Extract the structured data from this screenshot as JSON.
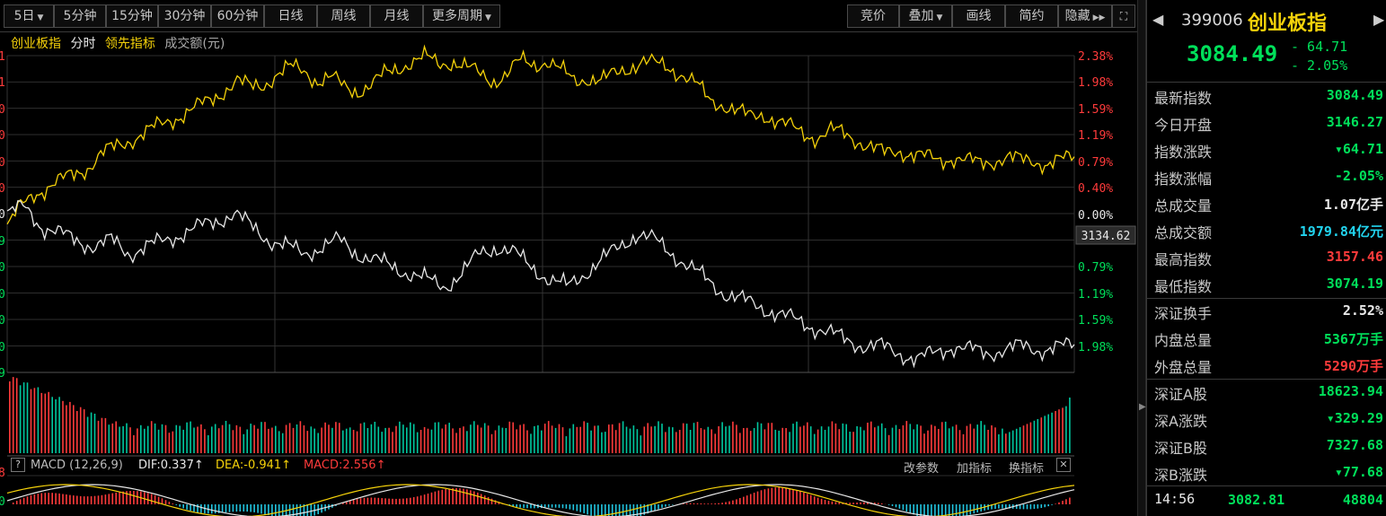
{
  "toolbar": {
    "period_items": [
      "5日",
      "5分钟",
      "15分钟",
      "30分钟",
      "60分钟",
      "日线",
      "周线",
      "月线",
      "更多周期"
    ],
    "right_items": [
      "竞价",
      "叠加",
      "画线",
      "简约",
      "隐藏"
    ]
  },
  "legend": {
    "items": [
      "创业板指",
      "分时",
      "领先指标",
      "成交额(元)"
    ]
  },
  "axis": {
    "right_labels_up": [
      "2.38%",
      "1.98%",
      "1.59%",
      "1.19%",
      "0.79%",
      "0.40%"
    ],
    "zero_label": "0.00%",
    "right_labels_down": [
      "0.79%",
      "1.19%",
      "1.59%",
      "1.98%"
    ],
    "prev_close": "3134.62",
    "left_labels": [
      "1",
      "1",
      "0",
      "0",
      "0",
      "0",
      "0",
      "9",
      "0",
      "0",
      "0",
      "0",
      "9"
    ]
  },
  "chart_data": {
    "type": "line",
    "series": [
      {
        "name": "领先指标",
        "color": "#f5d20a",
        "values": [
          -0.2,
          0.1,
          0.3,
          0.4,
          0.5,
          0.6,
          0.7,
          0.9,
          1.0,
          1.1,
          1.2,
          1.3,
          1.4,
          1.5,
          1.6,
          1.7,
          1.85,
          2.0,
          1.9,
          1.95,
          2.1,
          2.2,
          2.15,
          2.0,
          2.05,
          1.9,
          1.85,
          1.95,
          2.1,
          2.2,
          2.3,
          2.35,
          2.25,
          2.3,
          2.2,
          2.1,
          2.0,
          2.1,
          2.3,
          2.25,
          2.3,
          2.15,
          2.0,
          2.05,
          2.0,
          2.1,
          2.2,
          2.3,
          2.25,
          2.2,
          2.1,
          1.95,
          1.7,
          1.65,
          1.55,
          1.45,
          1.5,
          1.4,
          1.3,
          1.2,
          1.15,
          1.25,
          1.2,
          1.1,
          1.0,
          0.9,
          0.95,
          0.9,
          0.85,
          0.8,
          0.85,
          0.8,
          0.75,
          0.8,
          0.85,
          0.8,
          0.8,
          0.75,
          0.8,
          0.85
        ]
      },
      {
        "name": "创业板指",
        "color": "#e8e8e8",
        "values": [
          0.0,
          0.1,
          -0.2,
          -0.3,
          -0.4,
          -0.5,
          -0.4,
          -0.6,
          -0.5,
          -0.4,
          -0.3,
          -0.2,
          -0.1,
          0.0,
          -0.2,
          -0.4,
          -0.5,
          -0.6,
          -0.5,
          -0.4,
          -0.6,
          -0.7,
          -0.8,
          -0.9,
          -1.0,
          -1.1,
          -0.9,
          -0.6,
          -0.5,
          -0.6,
          -0.8,
          -1.0,
          -1.1,
          -0.9,
          -0.7,
          -0.5,
          -0.3,
          -0.4,
          -0.6,
          -0.8,
          -1.0,
          -1.2,
          -1.3,
          -1.4,
          -1.5,
          -1.6,
          -1.7,
          -1.8,
          -1.9,
          -2.0,
          -2.0,
          -2.1,
          -2.2,
          -2.1,
          -2.0,
          -2.05,
          -2.1,
          -2.05,
          -2.0,
          -2.05,
          -2.02,
          -1.98
        ]
      }
    ],
    "ylim": [
      -2.38,
      2.38
    ]
  },
  "volume": {
    "bars_count": 300
  },
  "macd": {
    "help": "?",
    "title": "MACD (12,26,9)",
    "dif": "DIF:0.337↑",
    "dea": "DEA:-0.941↑",
    "macd": "MACD:2.556↑",
    "actions": [
      "改参数",
      "加指标",
      "换指标"
    ],
    "left_labels": [
      "8",
      "0"
    ]
  },
  "panel": {
    "code": "399006",
    "name": "创业板指",
    "price": "3084.49",
    "change": "- 64.71",
    "change_pct": "- 2.05%",
    "rows": [
      {
        "label": "最新指数",
        "value": "3084.49",
        "cls": "green"
      },
      {
        "label": "今日开盘",
        "value": "3146.27",
        "cls": "green"
      },
      {
        "label": "指数涨跌",
        "value": "▾64.71",
        "cls": "green"
      },
      {
        "label": "指数涨幅",
        "value": "-2.05%",
        "cls": "green"
      },
      {
        "label": "总成交量",
        "value": "1.07亿手",
        "cls": "white"
      },
      {
        "label": "总成交额",
        "value": "1979.84亿元",
        "cls": "cyan"
      },
      {
        "label": "最高指数",
        "value": "3157.46",
        "cls": "red"
      },
      {
        "label": "最低指数",
        "value": "3074.19",
        "cls": "green"
      },
      {
        "label": "深证换手",
        "value": "2.52%",
        "cls": "white"
      },
      {
        "label": "内盘总量",
        "value": "5367万手",
        "cls": "green"
      },
      {
        "label": "外盘总量",
        "value": "5290万手",
        "cls": "red"
      },
      {
        "label": "深证A股",
        "value": "18623.94",
        "cls": "green"
      },
      {
        "label": "深A涨跌",
        "value": "▾329.29",
        "cls": "green"
      },
      {
        "label": "深证B股",
        "value": "7327.68",
        "cls": "green"
      },
      {
        "label": "深B涨跌",
        "value": "▾77.68",
        "cls": "green"
      }
    ],
    "tick": {
      "time": "14:56",
      "price": "3082.81",
      "volume": "48804"
    }
  }
}
